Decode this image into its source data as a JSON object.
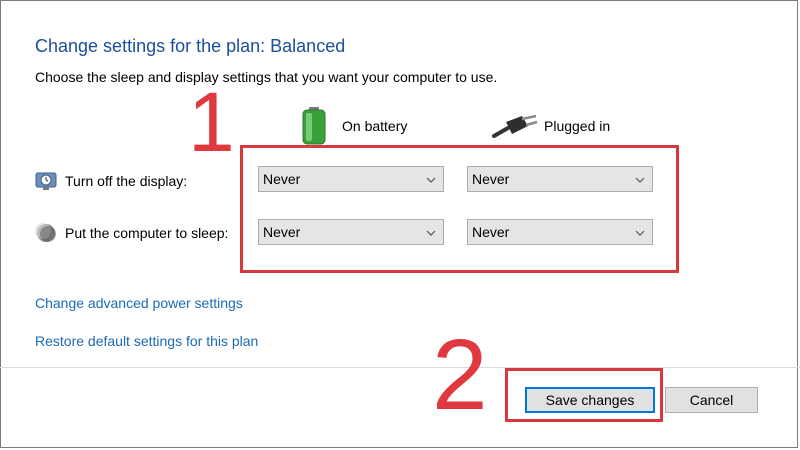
{
  "header": {
    "title": "Change settings for the plan: Balanced",
    "subtitle": "Choose the sleep and display settings that you want your computer to use."
  },
  "columns": {
    "battery": {
      "label": "On battery",
      "icon": "battery-icon"
    },
    "plugged": {
      "label": "Plugged in",
      "icon": "power-plug-icon"
    }
  },
  "rows": {
    "display": {
      "label": "Turn off the display:",
      "icon": "monitor-clock-icon",
      "battery_value": "Never",
      "plugged_value": "Never"
    },
    "sleep": {
      "label": "Put the computer to sleep:",
      "icon": "moon-icon",
      "battery_value": "Never",
      "plugged_value": "Never"
    }
  },
  "links": {
    "advanced": "Change advanced power settings",
    "restore": "Restore default settings for this plan"
  },
  "buttons": {
    "save": "Save changes",
    "cancel": "Cancel"
  },
  "annotations": {
    "step1": "1",
    "step2": "2"
  },
  "colors": {
    "title": "#1b4f99",
    "link": "#1a6bb5",
    "highlight": "#d63a3f",
    "focus": "#0078d7"
  }
}
